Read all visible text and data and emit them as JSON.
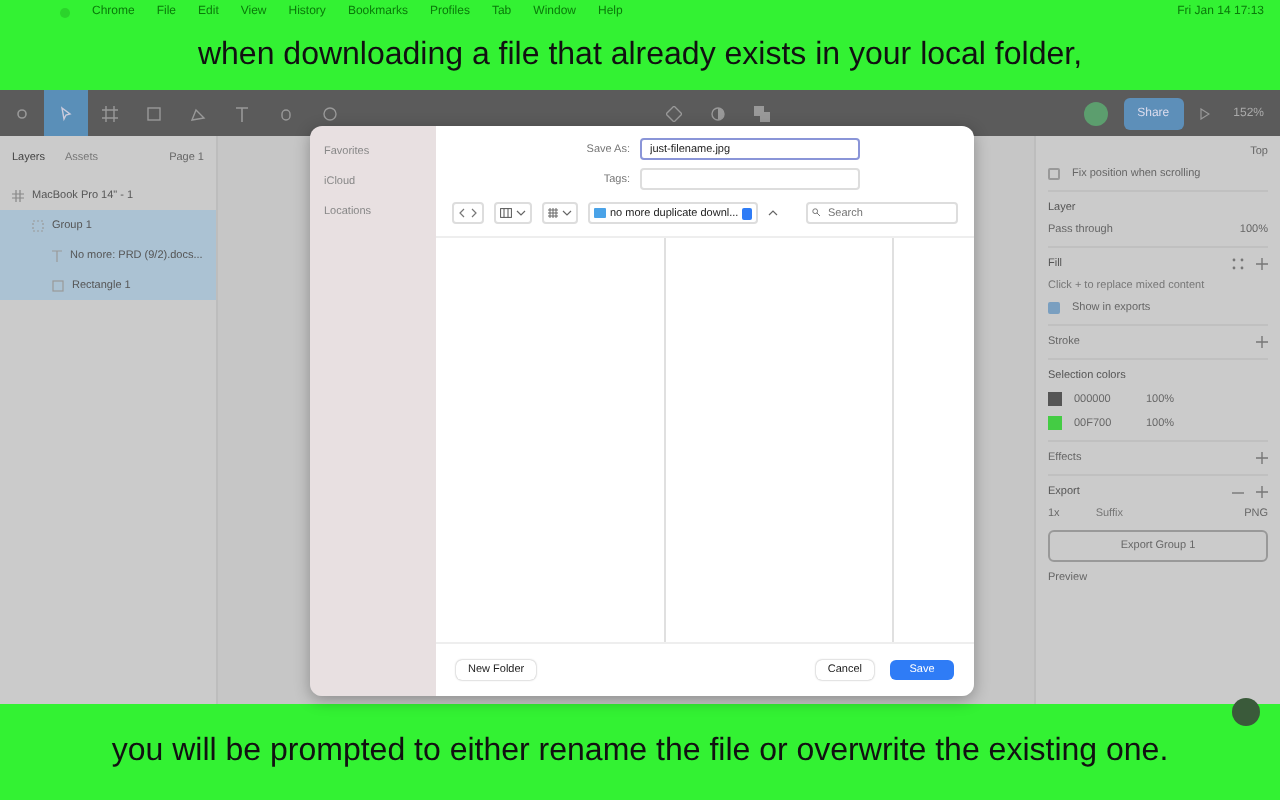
{
  "menu_bar": {
    "items": [
      "Chrome",
      "File",
      "Edit",
      "View",
      "History",
      "Bookmarks",
      "Profiles",
      "Tab",
      "Window",
      "Help"
    ],
    "clock": "Fri Jan 14  17:13"
  },
  "captions": {
    "top": "when downloading a file that already exists in your local folder,",
    "bottom": "you will be prompted to either rename the file or overwrite the existing one."
  },
  "toolbar": {
    "share": "Share",
    "zoom": "152%"
  },
  "layers_panel": {
    "tabs": [
      {
        "label": "Layers",
        "selected": true
      },
      {
        "label": "Assets",
        "selected": false
      }
    ],
    "page": "Page 1",
    "tree": [
      {
        "label": "MacBook Pro 14\" - 1",
        "kind": "frame",
        "selected": false,
        "children": [
          {
            "label": "Group 1",
            "kind": "group",
            "selected": true,
            "children": [
              {
                "label": "No more: PRD (9/2).docs...",
                "kind": "text",
                "selected": true
              },
              {
                "label": "Rectangle 1",
                "kind": "rect",
                "selected": true
              }
            ]
          }
        ]
      }
    ]
  },
  "design_panel": {
    "constraint": "Top",
    "fix_position": {
      "label": "Fix position when scrolling",
      "checked": false
    },
    "layer": {
      "title": "Layer",
      "blend": "Pass through",
      "opacity": "100%"
    },
    "fill": {
      "title": "Fill",
      "hint": "Click + to replace mixed content",
      "show_in_exports": {
        "label": "Show in exports",
        "checked": true
      }
    },
    "stroke": "Stroke",
    "selection_colors": {
      "title": "Selection colors",
      "items": [
        {
          "hex": "000000",
          "opacity": "100%",
          "color": "#555555"
        },
        {
          "hex": "00F700",
          "opacity": "100%",
          "color": "#44cc44"
        }
      ]
    },
    "effects": "Effects",
    "export": {
      "title": "Export",
      "scale": "1x",
      "suffix": "Suffix",
      "format": "PNG",
      "button": "Export Group 1",
      "preview": "Preview"
    }
  },
  "save_dialog": {
    "sidebar": [
      "Favorites",
      "iCloud",
      "Locations"
    ],
    "save_as_label": "Save As:",
    "save_as": "just-filename.jpg",
    "tags_label": "Tags:",
    "folder": "no more duplicate downl...",
    "search": {
      "placeholder": "Search"
    },
    "buttons": {
      "new_folder": "New Folder",
      "cancel": "Cancel",
      "save": "Save"
    }
  }
}
